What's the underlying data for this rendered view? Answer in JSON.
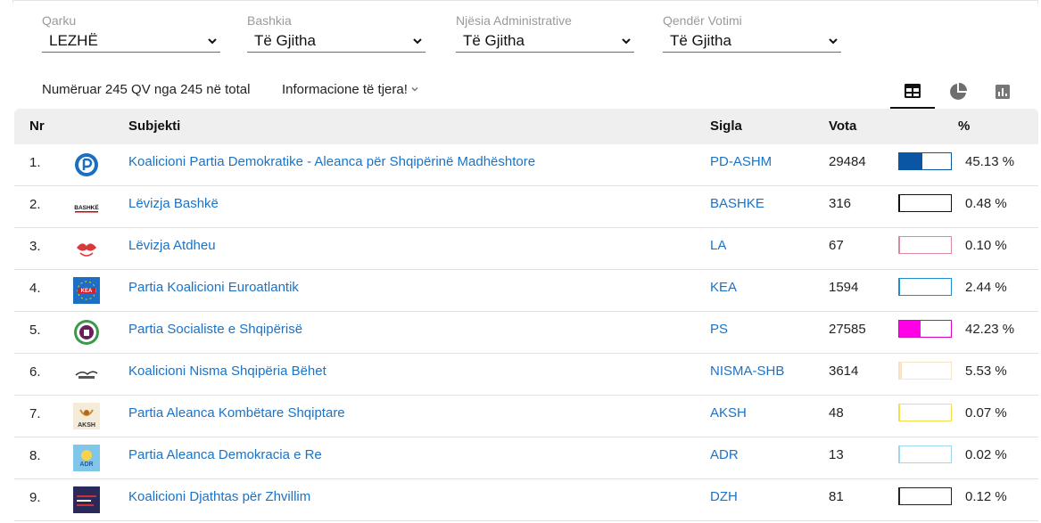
{
  "filters": [
    {
      "label": "Qarku",
      "value": "LEZHË"
    },
    {
      "label": "Bashkia",
      "value": "Të Gjitha"
    },
    {
      "label": "Njësia Administrative",
      "value": "Të Gjitha"
    },
    {
      "label": "Qendër Votimi",
      "value": "Të Gjitha"
    }
  ],
  "summary": "Numëruar 245 QV nga 245 në total",
  "more_info": "Informacione të tjera!",
  "views": [
    {
      "icon": "table-icon",
      "active": true
    },
    {
      "icon": "pie-chart-icon",
      "active": false
    },
    {
      "icon": "bar-chart-icon",
      "active": false
    }
  ],
  "table": {
    "headers": {
      "nr": "Nr",
      "subject": "Subjekti",
      "sigla": "Sigla",
      "votes": "Vota",
      "pct": "%"
    },
    "rows": [
      {
        "nr": "1.",
        "name": "Koalicioni Partia Demokratike - Aleanca për Shqipërinë Madhështore",
        "sigla": "PD-ASHM",
        "votes": "29484",
        "pct_text": "45.13 %",
        "pct": 45.13,
        "color": "#0b56a4",
        "border": "#0b56a4",
        "logo": "pd-logo"
      },
      {
        "nr": "2.",
        "name": "Lëvizja Bashkë",
        "sigla": "BASHKE",
        "votes": "316",
        "pct_text": "0.48 %",
        "pct": 0.48,
        "color": "#111111",
        "border": "#111111",
        "logo": "bashke-logo"
      },
      {
        "nr": "3.",
        "name": "Lëvizja Atdheu",
        "sigla": "LA",
        "votes": "67",
        "pct_text": "0.10 %",
        "pct": 0.1,
        "color": "#d98ca0",
        "border": "#d98ca0",
        "logo": "la-logo"
      },
      {
        "nr": "4.",
        "name": "Partia Koalicioni Euroatlantik",
        "sigla": "KEA",
        "votes": "1594",
        "pct_text": "2.44 %",
        "pct": 2.44,
        "color": "#1d8fd0",
        "border": "#1d8fd0",
        "logo": "kea-logo"
      },
      {
        "nr": "5.",
        "name": "Partia Socialiste e Shqipërisë",
        "sigla": "PS",
        "votes": "27585",
        "pct_text": "42.23 %",
        "pct": 42.23,
        "color": "#ff00e6",
        "border": "#d300c0",
        "logo": "ps-logo"
      },
      {
        "nr": "6.",
        "name": "Koalicioni Nisma Shqipëria Bëhet",
        "sigla": "NISMA-SHB",
        "votes": "3614",
        "pct_text": "5.53 %",
        "pct": 5.53,
        "color": "#f6e3c8",
        "border": "#f6e3c8",
        "logo": "nisma-logo"
      },
      {
        "nr": "7.",
        "name": "Partia Aleanca Kombëtare Shqiptare",
        "sigla": "AKSH",
        "votes": "48",
        "pct_text": "0.07 %",
        "pct": 0.07,
        "color": "#f4e04a",
        "border": "#f4e04a",
        "logo": "aksh-logo"
      },
      {
        "nr": "8.",
        "name": "Partia Aleanca Demokracia e Re",
        "sigla": "ADR",
        "votes": "13",
        "pct_text": "0.02 %",
        "pct": 0.02,
        "color": "#9fd6ee",
        "border": "#9fd6ee",
        "logo": "adr-logo"
      },
      {
        "nr": "9.",
        "name": "Koalicioni Djathtas për Zhvillim",
        "sigla": "DZH",
        "votes": "81",
        "pct_text": "0.12 %",
        "pct": 0.12,
        "color": "#222222",
        "border": "#222222",
        "logo": "dzh-logo"
      }
    ]
  },
  "logo_text": {
    "bashke": "BASHKË",
    "aksh": "AKSH",
    "adr": "ADR",
    "kea": "KEA"
  }
}
